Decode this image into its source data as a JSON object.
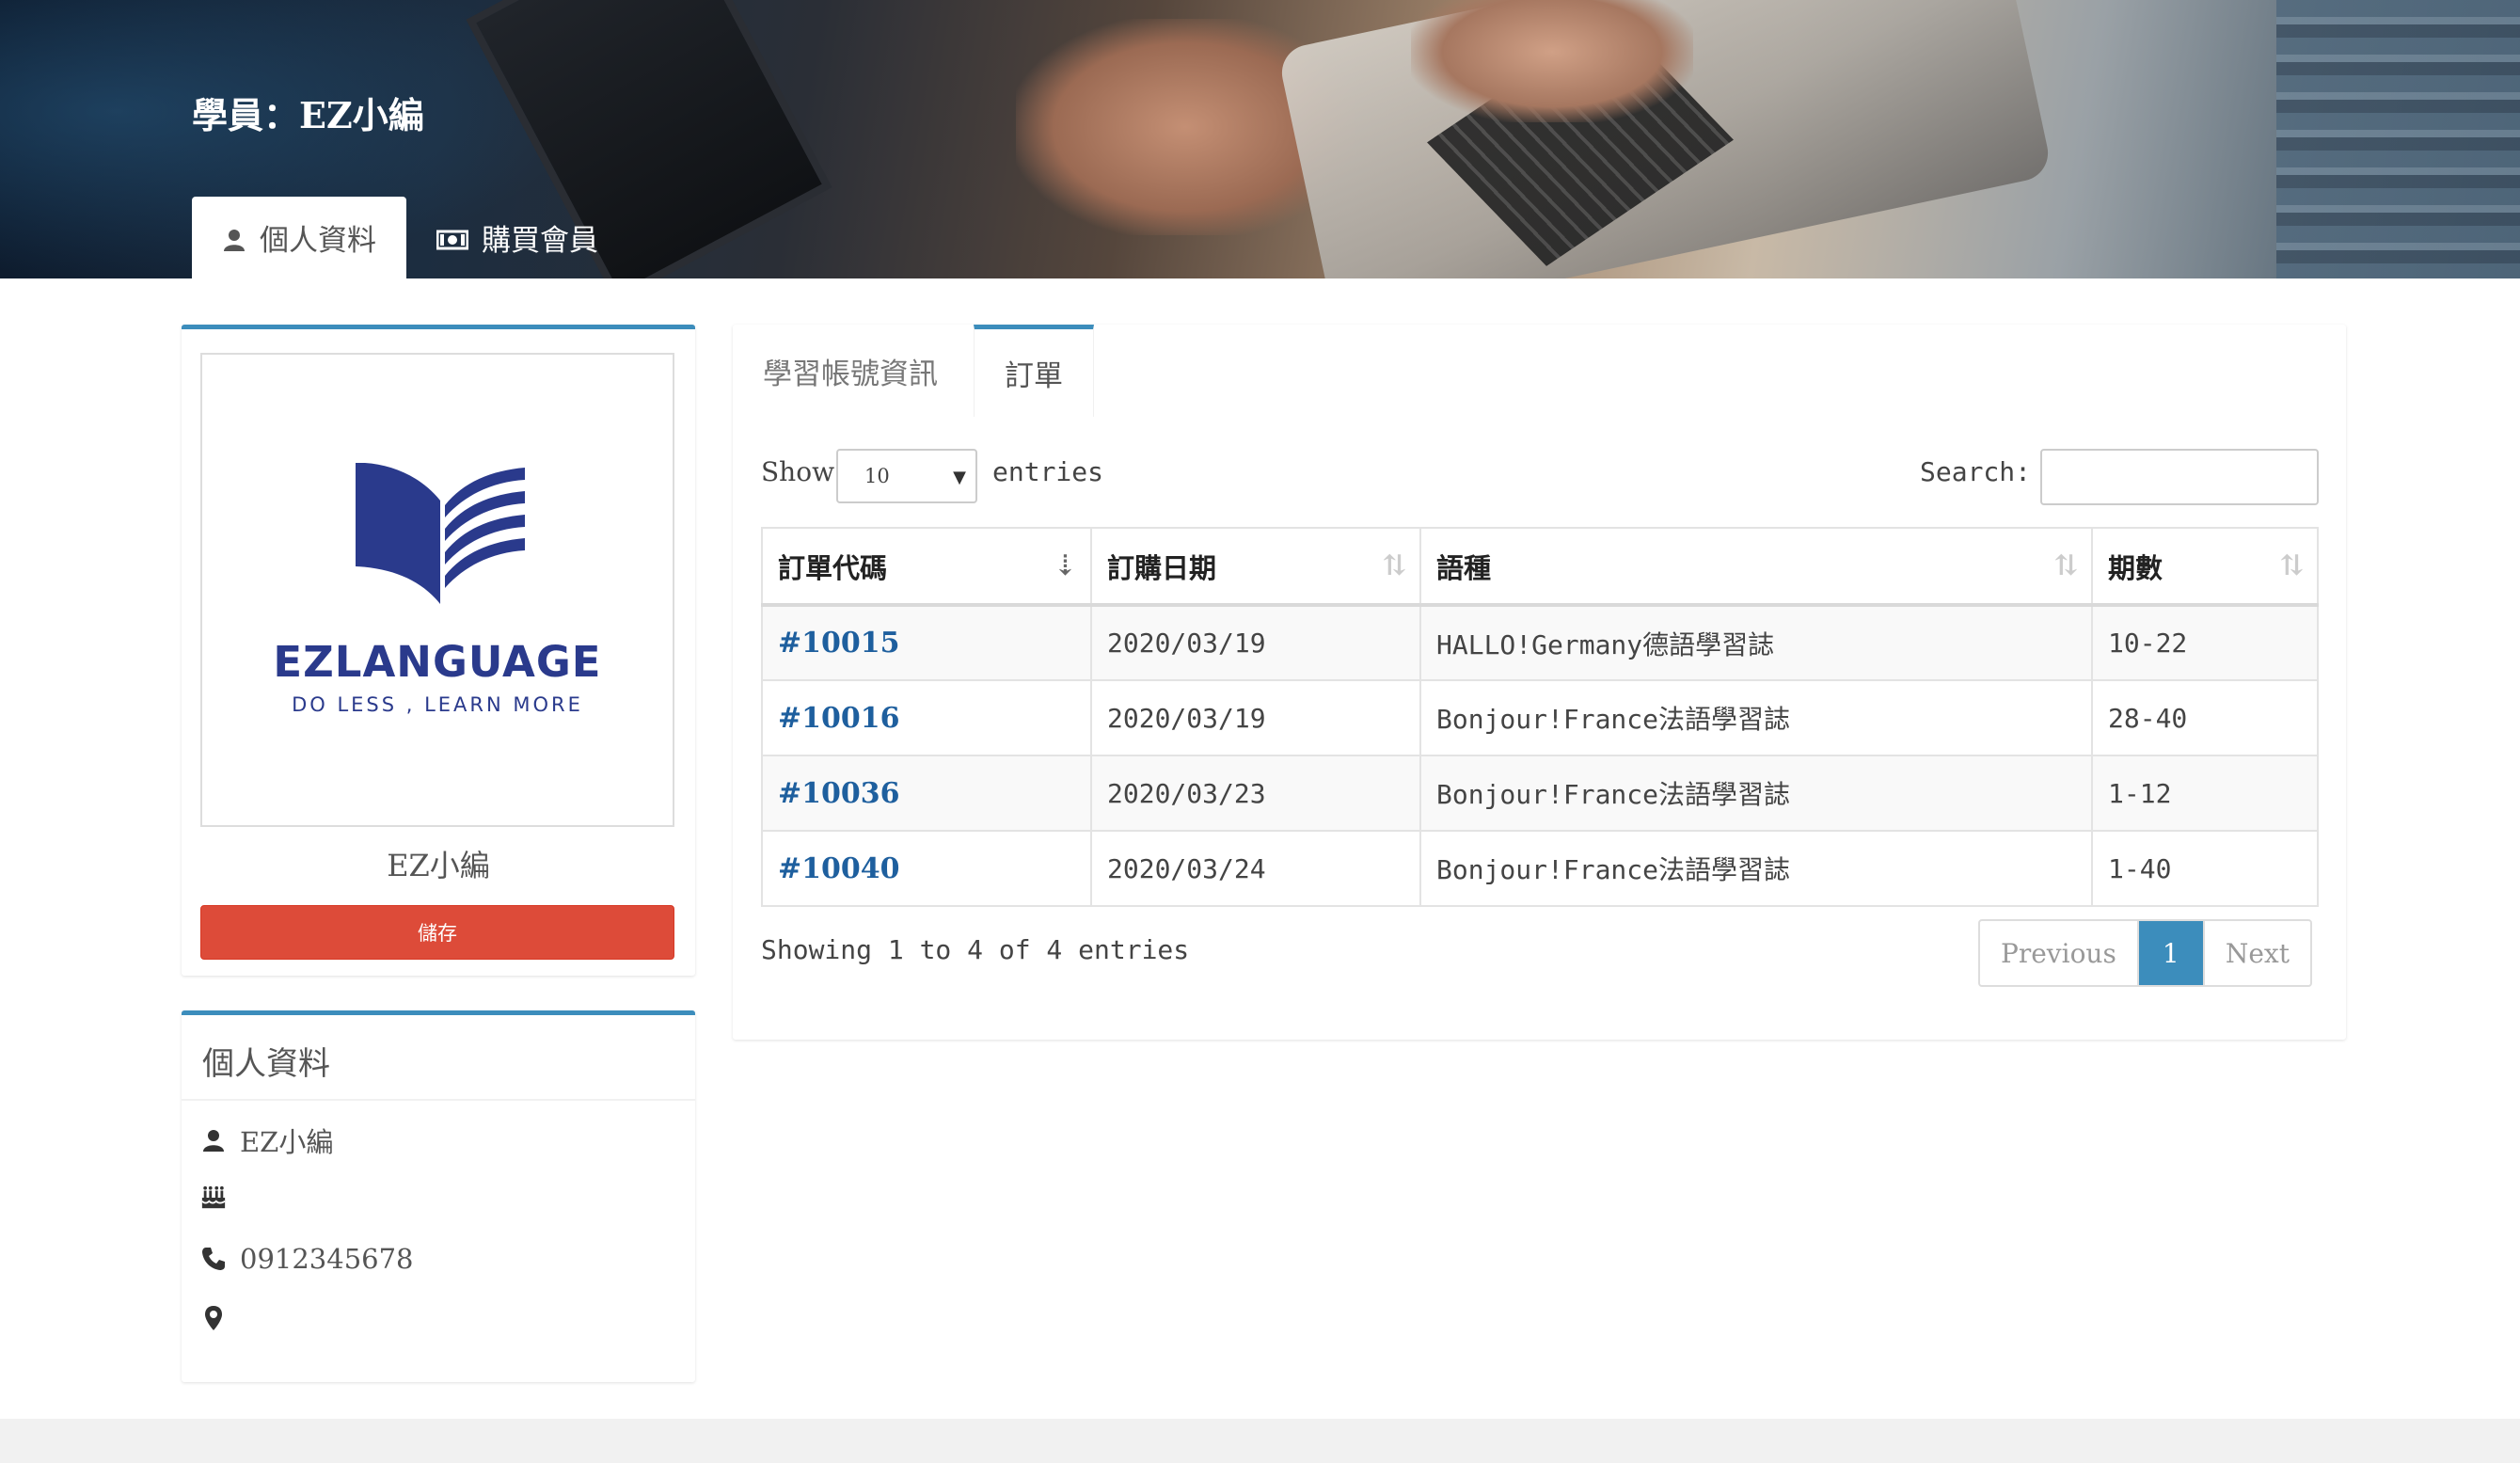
{
  "header": {
    "title": "學員：EZ小編",
    "tabs": [
      {
        "label": "個人資料",
        "icon": "user-icon",
        "active": true
      },
      {
        "label": "購買會員",
        "icon": "money-icon",
        "active": false
      }
    ]
  },
  "profile": {
    "logo_word": "EZLANGUAGE",
    "logo_tagline": "DO LESS , LEARN MORE",
    "name": "EZ小編",
    "save_label": "儲存"
  },
  "personal_info": {
    "title": "個人資料",
    "rows": [
      {
        "icon": "user-icon",
        "value": "EZ小編"
      },
      {
        "icon": "birthday-cake-icon",
        "value": ""
      },
      {
        "icon": "phone-icon",
        "value": "0912345678"
      },
      {
        "icon": "map-marker-icon",
        "value": ""
      }
    ]
  },
  "panel": {
    "tabs": [
      {
        "label": "學習帳號資訊",
        "active": false
      },
      {
        "label": "訂單",
        "active": true
      }
    ],
    "show_label": "Show",
    "page_length": "10",
    "entries_label": "entries",
    "search_label": "Search:",
    "search_value": "",
    "columns": [
      "訂單代碼",
      "訂購日期",
      "語種",
      "期數"
    ],
    "rows": [
      {
        "code": "#10015",
        "date": "2020/03/19",
        "language": "HALLO!Germany德語學習誌",
        "issues": "10-22"
      },
      {
        "code": "#10016",
        "date": "2020/03/19",
        "language": "Bonjour!France法語學習誌",
        "issues": "28-40"
      },
      {
        "code": "#10036",
        "date": "2020/03/23",
        "language": "Bonjour!France法語學習誌",
        "issues": "1-12"
      },
      {
        "code": "#10040",
        "date": "2020/03/24",
        "language": "Bonjour!France法語學習誌",
        "issues": "1-40"
      }
    ],
    "info": "Showing 1 to 4 of 4 entries",
    "pagination": {
      "previous": "Previous",
      "current": "1",
      "next": "Next"
    }
  },
  "colors": {
    "accent": "#3c8dbc",
    "danger": "#dd4b39",
    "link": "#1e5f9e",
    "logo": "#2a3a8c"
  }
}
